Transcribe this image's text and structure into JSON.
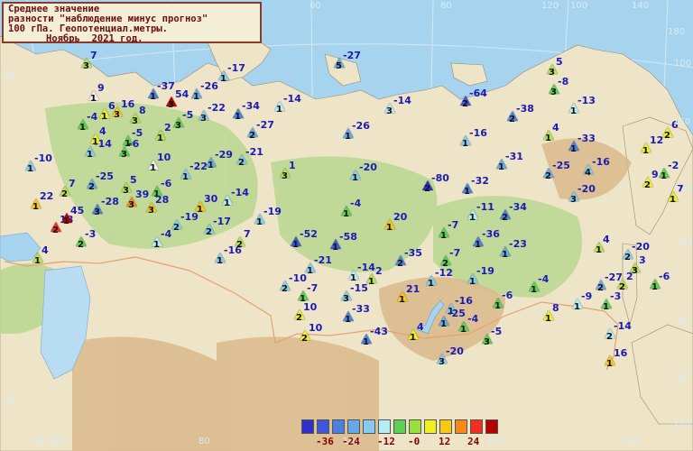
{
  "title": {
    "line1": "Среднее значение",
    "line2": "разности \"наблюдение минус прогноз\"",
    "line3": "100 гПа. Геопотенциал.метры.",
    "line4": "Ноябрь  2021 год."
  },
  "legend": {
    "colors": [
      "#3030c8",
      "#3c58d8",
      "#4c80e0",
      "#64a8e8",
      "#84ccf0",
      "#b4ecf8",
      "#5cd050",
      "#98e040",
      "#f0f020",
      "#f8c818",
      "#f88818",
      "#f03020",
      "#b80000"
    ],
    "ticks": [
      "-36",
      "-24",
      "-12",
      "-0",
      "12",
      "24"
    ]
  },
  "axis_labels": {
    "lon_top": [
      "60",
      "80",
      "100",
      "120",
      "140"
    ],
    "lat_right": [
      "40",
      "60",
      "80",
      "100",
      "120",
      "140",
      "160",
      "180"
    ],
    "lon_bottom": [
      "40",
      "60",
      "80",
      "100",
      "120",
      "140"
    ],
    "lat_left": [
      "40",
      "50"
    ]
  },
  "stations": [
    {
      "v": "7",
      "n": "3",
      "c": "#b8e050"
    },
    {
      "v": "9",
      "n": "1",
      "c": "#f0f0f0"
    },
    {
      "v": "-4",
      "n": "1",
      "c": "#5cd050"
    },
    {
      "v": "16",
      "n": "3",
      "c": "#f8c818"
    },
    {
      "v": "6",
      "n": "1",
      "c": "#f0f020"
    },
    {
      "v": "8",
      "n": "3",
      "c": "#b8e050"
    },
    {
      "v": "4",
      "n": "1",
      "c": "#f0f020"
    },
    {
      "v": "-5",
      "n": "1",
      "c": "#5cd050"
    },
    {
      "v": "-14",
      "n": "1",
      "c": "#84ccf0"
    },
    {
      "v": "-6",
      "n": "3",
      "c": "#5cd050"
    },
    {
      "v": "-10",
      "n": "1",
      "c": "#84ccf0"
    },
    {
      "v": "-25",
      "n": "2",
      "c": "#64a8e8"
    },
    {
      "v": "7",
      "n": "2",
      "c": "#b8e050"
    },
    {
      "v": "22",
      "n": "1",
      "c": "#f8c818"
    },
    {
      "v": "18",
      "n": "2",
      "c": "#f03020"
    },
    {
      "v": "45",
      "n": "1",
      "c": "#b80000"
    },
    {
      "v": "-3",
      "n": "2",
      "c": "#5cd050"
    },
    {
      "v": "4",
      "n": "1",
      "c": "#b8e050"
    },
    {
      "v": "-28",
      "n": "3",
      "c": "#4c80e0"
    },
    {
      "v": "5",
      "n": "3",
      "c": "#b8e050"
    },
    {
      "v": "39",
      "n": "3",
      "c": "#f88818"
    },
    {
      "v": "-6",
      "n": "1",
      "c": "#5cd050"
    },
    {
      "v": "28",
      "n": "3",
      "c": "#f8c818"
    },
    {
      "v": "10",
      "n": "1",
      "c": "#f0f0f0"
    },
    {
      "v": "-22",
      "n": "1",
      "c": "#84ccf0"
    },
    {
      "v": "-29",
      "n": "1",
      "c": "#64a8e8"
    },
    {
      "v": "-21",
      "n": "2",
      "c": "#84ccf0"
    },
    {
      "v": "30",
      "n": "1",
      "c": "#f8c818"
    },
    {
      "v": "-14",
      "n": "1",
      "c": "#b4ecf8"
    },
    {
      "v": "-19",
      "n": "2",
      "c": "#84ccf0"
    },
    {
      "v": "-4",
      "n": "1",
      "c": "#b4ecf8"
    },
    {
      "v": "-17",
      "n": "2",
      "c": "#84ccf0"
    },
    {
      "v": "-16",
      "n": "1",
      "c": "#84ccf0"
    },
    {
      "v": "7",
      "n": "2",
      "c": "#b8e050"
    },
    {
      "v": "-19",
      "n": "1",
      "c": "#84ccf0"
    },
    {
      "v": "-52",
      "n": "1",
      "c": "#3c58d8"
    },
    {
      "v": "-37",
      "n": "1",
      "c": "#4c80e0"
    },
    {
      "v": "54",
      "n": "3",
      "c": "#b80000"
    },
    {
      "v": "-26",
      "n": "1",
      "c": "#64a8e8"
    },
    {
      "v": "-17",
      "n": "1",
      "c": "#84ccf0"
    },
    {
      "v": "-5",
      "n": "3",
      "c": "#5cd050"
    },
    {
      "v": "2",
      "n": "1",
      "c": "#b8e050"
    },
    {
      "v": "-22",
      "n": "3",
      "c": "#84ccf0"
    },
    {
      "v": "-34",
      "n": "1",
      "c": "#4c80e0"
    },
    {
      "v": "-14",
      "n": "1",
      "c": "#b4ecf8"
    },
    {
      "v": "-27",
      "n": "2",
      "c": "#64a8e8"
    },
    {
      "v": "-27",
      "n": "5",
      "c": "#64a8e8"
    },
    {
      "v": "-14",
      "n": "3",
      "c": "#b4ecf8"
    },
    {
      "v": "-26",
      "n": "1",
      "c": "#64a8e8"
    },
    {
      "v": "1",
      "n": "3",
      "c": "#b8e050"
    },
    {
      "v": "-20",
      "n": "1",
      "c": "#84ccf0"
    },
    {
      "v": "-4",
      "n": "1",
      "c": "#5cd050"
    },
    {
      "v": "20",
      "n": "1",
      "c": "#f8c818"
    },
    {
      "v": "-80",
      "n": "2",
      "c": "#3030c8"
    },
    {
      "v": "-32",
      "n": "1",
      "c": "#4c80e0"
    },
    {
      "v": "-64",
      "n": "2",
      "c": "#3c58d8"
    },
    {
      "v": "-38",
      "n": "2",
      "c": "#4c80e0"
    },
    {
      "v": "-16",
      "n": "1",
      "c": "#84ccf0"
    },
    {
      "v": "-31",
      "n": "1",
      "c": "#64a8e8"
    },
    {
      "v": "-11",
      "n": "1",
      "c": "#b4ecf8"
    },
    {
      "v": "-34",
      "n": "2",
      "c": "#4c80e0"
    },
    {
      "v": "-7",
      "n": "1",
      "c": "#5cd050"
    },
    {
      "v": "-36",
      "n": "1",
      "c": "#4c80e0"
    },
    {
      "v": "-23",
      "n": "1",
      "c": "#64a8e8"
    },
    {
      "v": "-58",
      "n": "1",
      "c": "#3c58d8"
    },
    {
      "v": "-35",
      "n": "2",
      "c": "#4c80e0"
    },
    {
      "v": "-7",
      "n": "2",
      "c": "#5cd050"
    },
    {
      "v": "-21",
      "n": "1",
      "c": "#84ccf0"
    },
    {
      "v": "-10",
      "n": "2",
      "c": "#84ccf0"
    },
    {
      "v": "-7",
      "n": "1",
      "c": "#5cd050"
    },
    {
      "v": "10",
      "n": "2",
      "c": "#f0f020"
    },
    {
      "v": "-14",
      "n": "1",
      "c": "#b4ecf8"
    },
    {
      "v": "2",
      "n": "1",
      "c": "#b8e050"
    },
    {
      "v": "-15",
      "n": "3",
      "c": "#84ccf0"
    },
    {
      "v": "-33",
      "n": "1",
      "c": "#4c80e0"
    },
    {
      "v": "21",
      "n": "1",
      "c": "#f8c818"
    },
    {
      "v": "-12",
      "n": "1",
      "c": "#84ccf0"
    },
    {
      "v": "-19",
      "n": "1",
      "c": "#84ccf0"
    },
    {
      "v": "-16",
      "n": "1",
      "c": "#84ccf0"
    },
    {
      "v": "-25",
      "n": "1",
      "c": "#64a8e8"
    },
    {
      "v": "-4",
      "n": "1",
      "c": "#5cd050"
    },
    {
      "v": "10",
      "n": "2",
      "c": "#f0f020"
    },
    {
      "v": "4",
      "n": "1",
      "c": "#f0f020"
    },
    {
      "v": "-43",
      "n": "1",
      "c": "#4c80e0"
    },
    {
      "v": "-20",
      "n": "3",
      "c": "#84ccf0"
    },
    {
      "v": "-5",
      "n": "3",
      "c": "#5cd050"
    },
    {
      "v": "-6",
      "n": "1",
      "c": "#5cd050"
    },
    {
      "v": "-4",
      "n": "1",
      "c": "#5cd050"
    },
    {
      "v": "8",
      "n": "1",
      "c": "#f0f020"
    },
    {
      "v": "-9",
      "n": "1",
      "c": "#b4ecf8"
    },
    {
      "v": "-3",
      "n": "1",
      "c": "#5cd050"
    },
    {
      "v": "-14",
      "n": "2",
      "c": "#b4ecf8"
    },
    {
      "v": "16",
      "n": "1",
      "c": "#f8c818"
    },
    {
      "v": "5",
      "n": "3",
      "c": "#b8e050"
    },
    {
      "v": "-8",
      "n": "3",
      "c": "#5cd050"
    },
    {
      "v": "-13",
      "n": "1",
      "c": "#b4ecf8"
    },
    {
      "v": "4",
      "n": "1",
      "c": "#b8e050"
    },
    {
      "v": "-33",
      "n": "1",
      "c": "#4c80e0"
    },
    {
      "v": "-25",
      "n": "2",
      "c": "#64a8e8"
    },
    {
      "v": "-16",
      "n": "4",
      "c": "#84ccf0"
    },
    {
      "v": "-20",
      "n": "3",
      "c": "#84ccf0"
    },
    {
      "v": "6",
      "n": "2",
      "c": "#f0f020"
    },
    {
      "v": "12",
      "n": "1",
      "c": "#f0f020"
    },
    {
      "v": "-2",
      "n": "1",
      "c": "#5cd050"
    },
    {
      "v": "9",
      "n": "2",
      "c": "#f0f020"
    },
    {
      "v": "7",
      "n": "1",
      "c": "#f0f020"
    },
    {
      "v": "4",
      "n": "1",
      "c": "#b8e050"
    },
    {
      "v": "-20",
      "n": "2",
      "c": "#84ccf0"
    },
    {
      "v": "3",
      "n": "3",
      "c": "#b8e050"
    },
    {
      "v": "-27",
      "n": "2",
      "c": "#64a8e8"
    },
    {
      "v": "2",
      "n": "2",
      "c": "#b8e050"
    },
    {
      "v": "-6",
      "n": "1",
      "c": "#5cd050"
    }
  ]
}
